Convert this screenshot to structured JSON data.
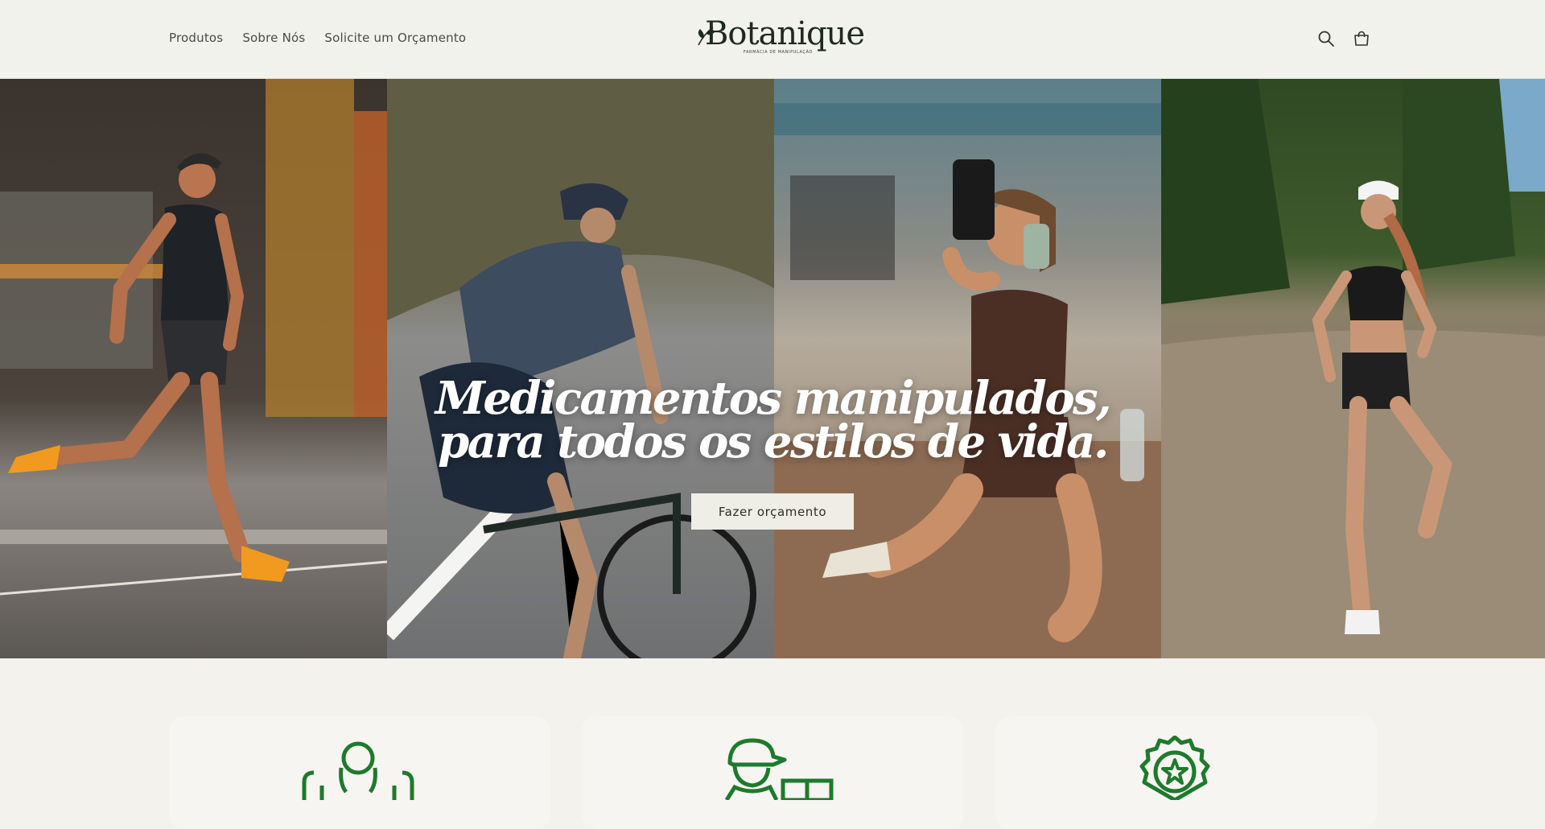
{
  "nav": {
    "items": [
      {
        "label": "Produtos"
      },
      {
        "label": "Sobre Nós"
      },
      {
        "label": "Solicite um Orçamento"
      }
    ]
  },
  "logo": {
    "name": "Botanique",
    "tagline": "FARMÁCIA DE MANIPULAÇÃO"
  },
  "header_icons": [
    "search-icon",
    "cart-icon"
  ],
  "hero": {
    "title_line1": "Medicamentos manipulados,",
    "title_line2": "para todos os estilos de vida.",
    "button_label": "Fazer orçamento"
  },
  "features": [
    {
      "icon": "customer-service-icon"
    },
    {
      "icon": "delivery-person-icon"
    },
    {
      "icon": "quality-badge-icon"
    }
  ],
  "colors": {
    "header_bg": "#f1f2ec",
    "page_bg": "#f3f2ec",
    "icon_green": "#1e7a2c",
    "button_bg": "#eeede6"
  }
}
